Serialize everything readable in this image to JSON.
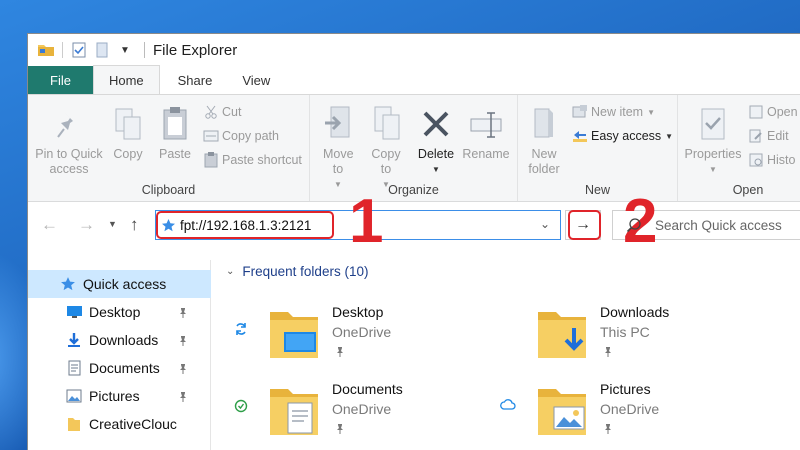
{
  "window": {
    "title": "File Explorer"
  },
  "ribbon_tabs": [
    {
      "label": "File"
    },
    {
      "label": "Home"
    },
    {
      "label": "Share"
    },
    {
      "label": "View"
    }
  ],
  "clipboard": {
    "group_label": "Clipboard",
    "pin_quick_access": "Pin to Quick access",
    "copy": "Copy",
    "paste": "Paste",
    "cut": "Cut",
    "copy_path": "Copy path",
    "paste_shortcut": "Paste shortcut"
  },
  "organize": {
    "group_label": "Organize",
    "move_to": "Move to",
    "copy_to": "Copy to",
    "delete": "Delete",
    "rename": "Rename"
  },
  "new": {
    "group_label": "New",
    "new_folder": "New folder",
    "new_item": "New item",
    "easy_access": "Easy access"
  },
  "open": {
    "group_label": "Open",
    "properties": "Properties",
    "open": "Open",
    "edit": "Edit",
    "history": "Histo"
  },
  "address": {
    "value": "fpt://192.168.1.3:2121",
    "search_placeholder": "Search Quick access"
  },
  "annotations": {
    "step1": "1",
    "step2": "2"
  },
  "nav_pane": {
    "items": [
      {
        "label": "Quick access",
        "icon": "star-icon"
      },
      {
        "label": "Desktop",
        "icon": "desktop-icon"
      },
      {
        "label": "Downloads",
        "icon": "download-icon"
      },
      {
        "label": "Documents",
        "icon": "documents-icon"
      },
      {
        "label": "Pictures",
        "icon": "pictures-icon"
      },
      {
        "label": "CreativeClouc",
        "icon": "folder-icon"
      }
    ]
  },
  "content": {
    "section_title": "Frequent folders (10)",
    "folders": [
      {
        "name": "Desktop",
        "location": "OneDrive",
        "status_icon": "sync-icon"
      },
      {
        "name": "Downloads",
        "location": "This PC",
        "status_icon": ""
      },
      {
        "name": "Documents",
        "location": "OneDrive",
        "status_icon": "check-circle-icon"
      },
      {
        "name": "Pictures",
        "location": "OneDrive",
        "status_icon": "cloud-icon"
      }
    ]
  },
  "colors": {
    "file_tab": "#1f7a6e",
    "selection": "#cde8ff",
    "accent_blue": "#3b8ee8",
    "annotation_red": "#e0242a",
    "folder_yellow": "#f3c75a"
  }
}
